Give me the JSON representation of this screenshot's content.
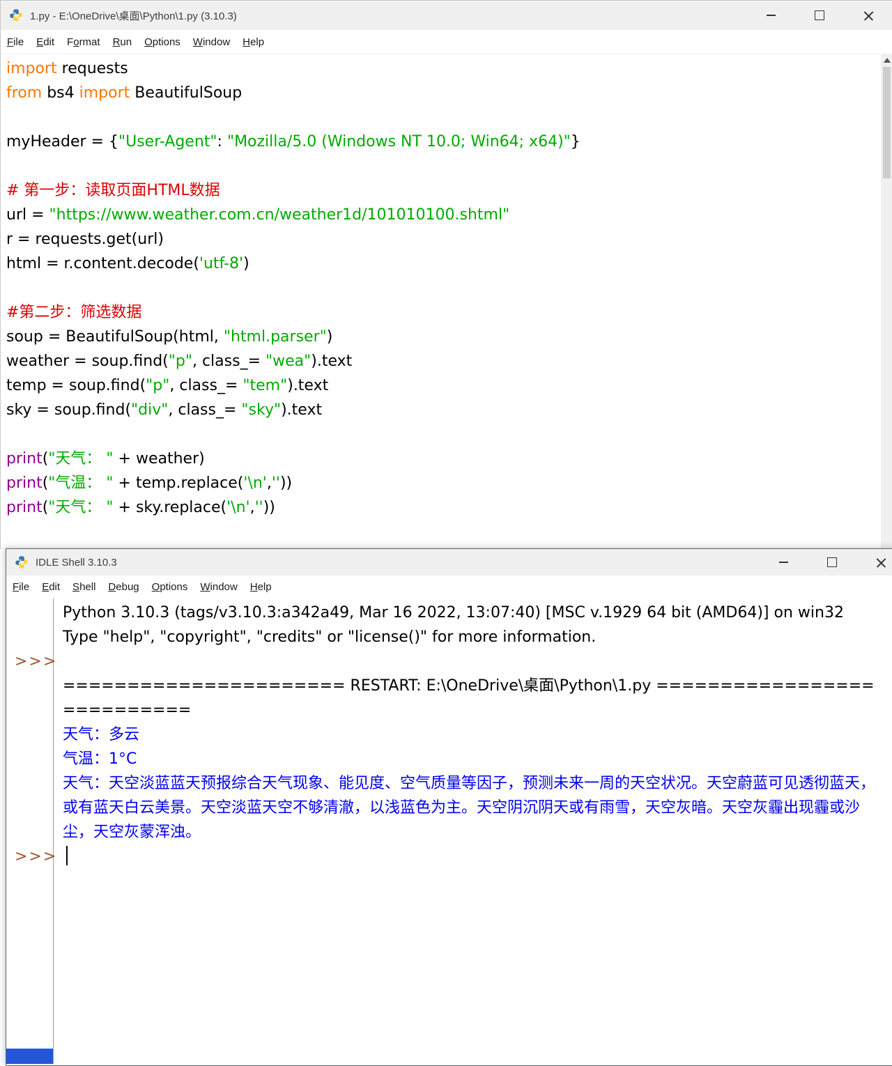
{
  "colors": {
    "keyword": "#FF7700",
    "string": "#00AA00",
    "comment": "#DD0000",
    "builtin": "#900090",
    "stdout": "#0000EE",
    "prompt": "#A0522D",
    "titlebar_bg": "#f0f0f0",
    "strip_blue": "#2456d8"
  },
  "editor_window": {
    "title": "1.py - E:\\OneDrive\\桌面\\Python\\1.py (3.10.3)",
    "menus": [
      {
        "label": "File",
        "u": 0
      },
      {
        "label": "Edit",
        "u": 0
      },
      {
        "label": "Format",
        "u": 1
      },
      {
        "label": "Run",
        "u": 0
      },
      {
        "label": "Options",
        "u": 0
      },
      {
        "label": "Window",
        "u": 0
      },
      {
        "label": "Help",
        "u": 0
      }
    ],
    "code_lines": [
      [
        [
          "k",
          "import"
        ],
        [
          "p",
          " requests"
        ]
      ],
      [
        [
          "k",
          "from"
        ],
        [
          "p",
          " bs4 "
        ],
        [
          "k",
          "import"
        ],
        [
          "p",
          " BeautifulSoup"
        ]
      ],
      [],
      [
        [
          "p",
          "myHeader = {"
        ],
        [
          "s",
          "\"User-Agent\""
        ],
        [
          "p",
          ": "
        ],
        [
          "s",
          "\"Mozilla/5.0 (Windows NT 10.0; Win64; x64)\""
        ],
        [
          "p",
          "}"
        ]
      ],
      [],
      [
        [
          "c",
          "# 第一步：读取页面HTML数据"
        ]
      ],
      [
        [
          "p",
          "url = "
        ],
        [
          "s",
          "\"https://www.weather.com.cn/weather1d/101010100.shtml\""
        ]
      ],
      [
        [
          "p",
          "r = requests.get(url)"
        ]
      ],
      [
        [
          "p",
          "html = r.content.decode("
        ],
        [
          "s",
          "'utf-8'"
        ],
        [
          "p",
          ")"
        ]
      ],
      [],
      [
        [
          "c",
          "#第二步：筛选数据"
        ]
      ],
      [
        [
          "p",
          "soup = BeautifulSoup(html, "
        ],
        [
          "s",
          "\"html.parser\""
        ],
        [
          "p",
          ")"
        ]
      ],
      [
        [
          "p",
          "weather = soup.find("
        ],
        [
          "s",
          "\"p\""
        ],
        [
          "p",
          ", class_= "
        ],
        [
          "s",
          "\"wea\""
        ],
        [
          "p",
          ").text"
        ]
      ],
      [
        [
          "p",
          "temp = soup.find("
        ],
        [
          "s",
          "\"p\""
        ],
        [
          "p",
          ", class_= "
        ],
        [
          "s",
          "\"tem\""
        ],
        [
          "p",
          ").text"
        ]
      ],
      [
        [
          "p",
          "sky = soup.find("
        ],
        [
          "s",
          "\"div\""
        ],
        [
          "p",
          ", class_= "
        ],
        [
          "s",
          "\"sky\""
        ],
        [
          "p",
          ").text"
        ]
      ],
      [],
      [
        [
          "b",
          "print"
        ],
        [
          "p",
          "("
        ],
        [
          "s",
          "\"天气： \""
        ],
        [
          "p",
          " + weather)"
        ]
      ],
      [
        [
          "b",
          "print"
        ],
        [
          "p",
          "("
        ],
        [
          "s",
          "\"气温： \""
        ],
        [
          "p",
          " + temp.replace("
        ],
        [
          "s",
          "'\\n'"
        ],
        [
          "p",
          ","
        ],
        [
          "s",
          "''"
        ],
        [
          "p",
          "))"
        ]
      ],
      [
        [
          "b",
          "print"
        ],
        [
          "p",
          "("
        ],
        [
          "s",
          "\"天气： \""
        ],
        [
          "p",
          " + sky.replace("
        ],
        [
          "s",
          "'\\n'"
        ],
        [
          "p",
          ","
        ],
        [
          "s",
          "''"
        ],
        [
          "p",
          "))"
        ]
      ]
    ]
  },
  "shell_window": {
    "title": "IDLE Shell 3.10.3",
    "menus": [
      {
        "label": "File",
        "u": 0
      },
      {
        "label": "Edit",
        "u": 0
      },
      {
        "label": "Shell",
        "u": 0
      },
      {
        "label": "Debug",
        "u": 0
      },
      {
        "label": "Options",
        "u": 0
      },
      {
        "label": "Window",
        "u": 0
      },
      {
        "label": "Help",
        "u": 0
      }
    ],
    "rows": [
      {
        "prompt": "",
        "cls": "",
        "text": "Python 3.10.3 (tags/v3.10.3:a342a49, Mar 16 2022, 13:07:40) [MSC v.1929 64 bit (AMD64)] on win32"
      },
      {
        "prompt": "",
        "cls": "",
        "text": "Type \"help\", \"copyright\", \"credits\" or \"license()\" for more information."
      },
      {
        "prompt": ">>>",
        "cls": "",
        "text": ""
      },
      {
        "prompt": "",
        "cls": "",
        "text": "====================== RESTART: E:\\OneDrive\\桌面\\Python\\1.py ==========================="
      },
      {
        "prompt": "",
        "cls": "stdout",
        "text": "天气：多云"
      },
      {
        "prompt": "",
        "cls": "stdout",
        "text": "气温：1°C"
      },
      {
        "prompt": "",
        "cls": "stdout",
        "text": "天气：天空淡蓝蓝天预报综合天气现象、能见度、空气质量等因子，预测未来一周的天空状况。天空蔚蓝可见透彻蓝天，或有蓝天白云美景。天空淡蓝天空不够清澈，以浅蓝色为主。天空阴沉阴天或有雨雪，天空灰暗。天空灰霾出现霾或沙尘，天空灰蒙浑浊。"
      },
      {
        "prompt": ">>>",
        "cls": "",
        "text": "",
        "cursor": true
      }
    ]
  }
}
